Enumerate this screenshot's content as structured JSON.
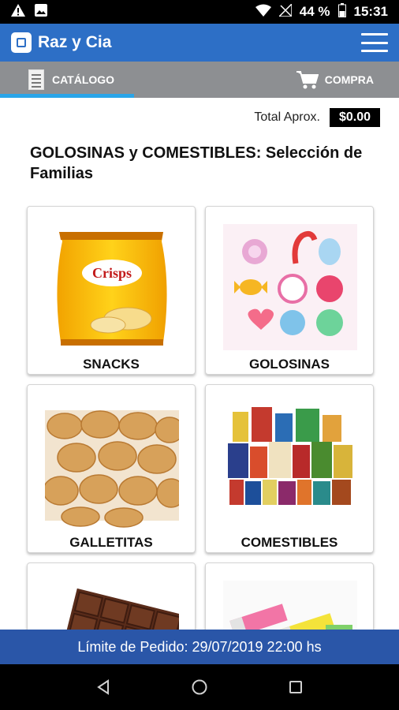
{
  "status_bar": {
    "battery": "44 %",
    "time": "15:31",
    "icons": [
      "warning-icon",
      "image-icon",
      "wifi-icon",
      "no-signal-icon",
      "battery-icon"
    ]
  },
  "app_bar": {
    "title": "Raz y Cia",
    "menu_icon": "hamburger-menu-icon"
  },
  "tabs": [
    {
      "label": "CATÁLOGO",
      "icon": "document-icon",
      "selected": true
    },
    {
      "label": "COMPRA",
      "icon": "cart-icon",
      "selected": false
    }
  ],
  "colors": {
    "app_bar": "#2d6fc6",
    "tab_bar": "#8d8f92",
    "tab_indicator": "#2aa5e8",
    "deadline_bar": "#2a56a8"
  },
  "total": {
    "label": "Total Aprox.",
    "value": "$0.00"
  },
  "heading": "GOLOSINAS y COMESTIBLES: Selección de Familias",
  "families": [
    {
      "label": "SNACKS",
      "image": "chips-bag"
    },
    {
      "label": "GOLOSINAS",
      "image": "candies"
    },
    {
      "label": "GALLETITAS",
      "image": "cookies"
    },
    {
      "label": "COMESTIBLES",
      "image": "groceries"
    },
    {
      "label": "",
      "image": "chocolate-bar"
    },
    {
      "label": "",
      "image": "chewing-gum"
    }
  ],
  "deadline": "Límite de Pedido: 29/07/2019 22:00 hs",
  "nav_bar": [
    "back-icon",
    "home-icon",
    "recents-icon"
  ]
}
